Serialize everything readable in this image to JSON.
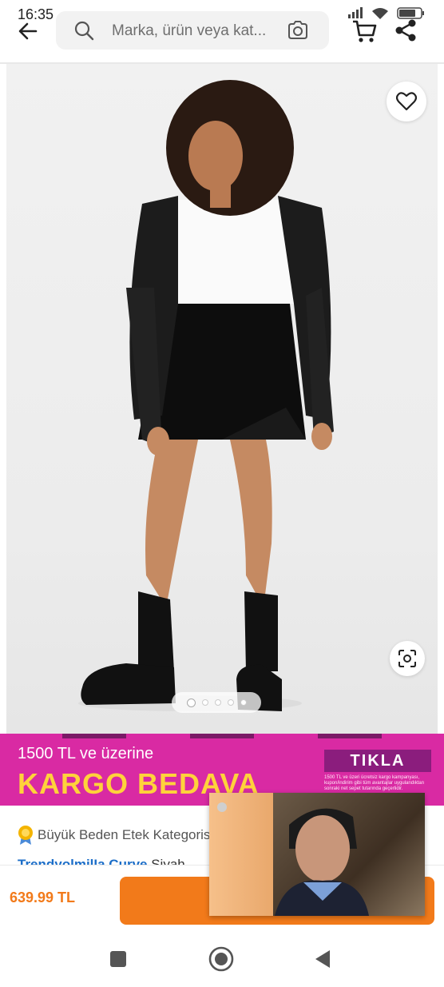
{
  "status": {
    "time": "16:35",
    "battery": "73"
  },
  "header": {
    "search_placeholder": "Marka, ürün veya kat..."
  },
  "gallery": {
    "image_count": 5,
    "active_index": 0
  },
  "promo": {
    "line1": "1500 TL ve üzerine",
    "line2": "KARGO BEDAVA",
    "cta": "TIKLA",
    "fine_print": "1500 TL ve üzeri ücretsiz kargo kampanyası, kupon/indirim gibi tüm avantajlar uygulandıktan sonraki net sepet tutarında geçerlidir."
  },
  "product": {
    "category": "Büyük Beden Etek Kategorisi",
    "brand": "TrendyolmilIa Curve",
    "title_rest": " Siyah",
    "price": "639.99 TL"
  },
  "colors": {
    "accent": "#f27a1a",
    "promo_bg": "#d92aa3",
    "promo_yellow": "#ffd23b",
    "brand_blue": "#1c6ec8"
  },
  "icons": [
    "back-arrow-icon",
    "search-icon",
    "camera-icon",
    "cart-icon",
    "share-icon",
    "heart-icon",
    "scan-icon",
    "recents-icon",
    "home-icon",
    "back-icon"
  ]
}
